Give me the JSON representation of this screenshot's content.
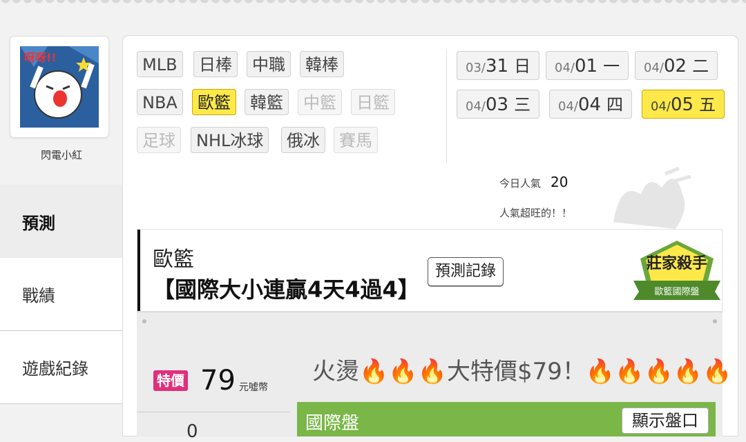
{
  "user": {
    "name": "閃電小紅"
  },
  "nav": [
    {
      "label": "預測",
      "active": true
    },
    {
      "label": "戰績",
      "active": false
    },
    {
      "label": "遊戲紀錄",
      "active": false
    }
  ],
  "sports": [
    {
      "label": "MLB",
      "state": "normal"
    },
    {
      "label": "日棒",
      "state": "normal"
    },
    {
      "label": "中職",
      "state": "normal"
    },
    {
      "label": "韓棒",
      "state": "normal"
    },
    {
      "label": "NBA",
      "state": "normal"
    },
    {
      "label": "歐籃",
      "state": "selected"
    },
    {
      "label": "韓籃",
      "state": "normal"
    },
    {
      "label": "中籃",
      "state": "disabled"
    },
    {
      "label": "日籃",
      "state": "disabled"
    },
    {
      "label": "足球",
      "state": "disabled"
    },
    {
      "label": "NHL冰球",
      "state": "normal"
    },
    {
      "label": "俄冰",
      "state": "normal"
    },
    {
      "label": "賽馬",
      "state": "disabled"
    }
  ],
  "dates": [
    {
      "md": "03/",
      "day": "31",
      "weekday": "日",
      "selected": false
    },
    {
      "md": "04/",
      "day": "01",
      "weekday": "一",
      "selected": false
    },
    {
      "md": "04/",
      "day": "02",
      "weekday": "二",
      "selected": false
    },
    {
      "md": "04/",
      "day": "03",
      "weekday": "三",
      "selected": false
    },
    {
      "md": "04/",
      "day": "04",
      "weekday": "四",
      "selected": false
    },
    {
      "md": "04/",
      "day": "05",
      "weekday": "五",
      "selected": true
    }
  ],
  "popularity": {
    "label": "今日人氣",
    "value": "20",
    "note": "人氣超旺的！！"
  },
  "prediction": {
    "category": "歐籃",
    "title": "【國際大小連贏4天4過4】",
    "record_button": "預測記錄",
    "badge_main": "莊家殺手",
    "badge_sub": "歐籃國際盤"
  },
  "price": {
    "tag": "特價",
    "value": "79",
    "unit": "元噓幣",
    "promo": "火燙🔥🔥🔥大特價$79！🔥🔥🔥🔥🔥"
  },
  "market": {
    "title": "國際盤",
    "show_button": "顯示盤口"
  },
  "partial": {
    "number": "0"
  },
  "colors": {
    "accent_yellow": "#ffe94a",
    "special_pink": "#e0307a",
    "market_green": "#7ab648"
  }
}
